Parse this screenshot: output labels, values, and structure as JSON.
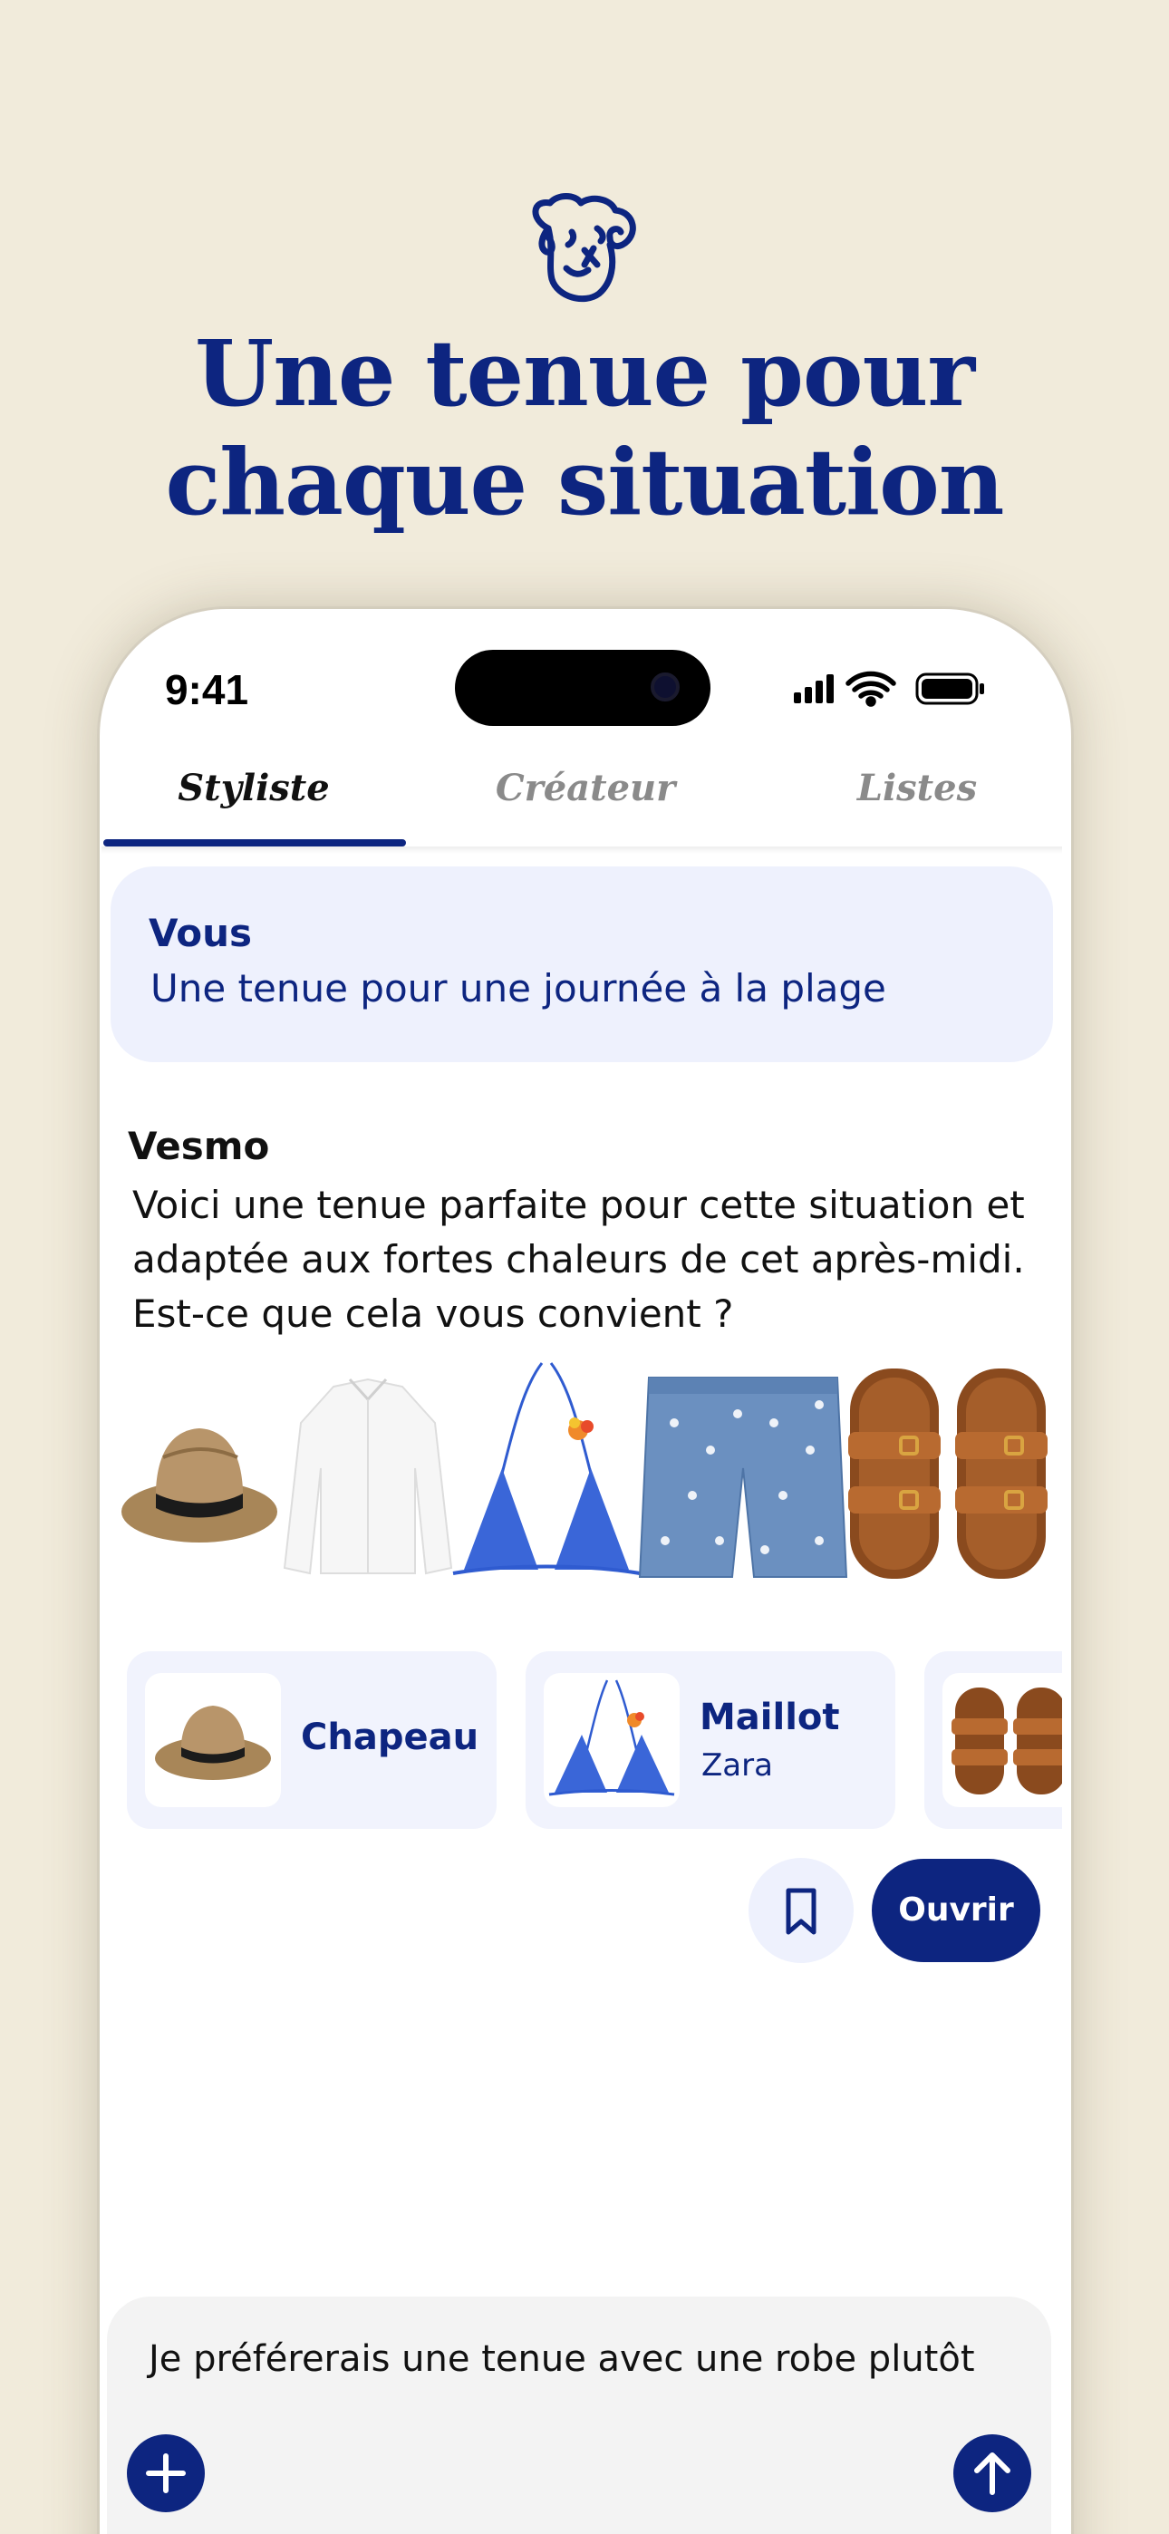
{
  "headline": {
    "line1": "Une tenue pour",
    "line2": "chaque situation"
  },
  "status_bar": {
    "time": "9:41",
    "icons": [
      "signal-icon",
      "wifi-icon",
      "battery-icon"
    ]
  },
  "tabs": [
    {
      "label": "Styliste",
      "active": true
    },
    {
      "label": "Créateur",
      "active": false
    },
    {
      "label": "Listes",
      "active": false
    }
  ],
  "chat": {
    "user": {
      "name": "Vous",
      "message": "Une tenue pour une journée à la plage"
    },
    "bot": {
      "name": "Vesmo",
      "message": "Voici une tenue parfaite pour cette situation et adaptée aux fortes chaleurs de cet après-midi. Est-ce que cela vous convient ?"
    }
  },
  "outfit_items": [
    "hat",
    "white-shirt",
    "bikini",
    "denim-shorts",
    "sandals"
  ],
  "product_cards": [
    {
      "title": "Chapeau",
      "subtitle": ""
    },
    {
      "title": "Maillot",
      "subtitle": "Zara"
    },
    {
      "title": "",
      "subtitle": ""
    }
  ],
  "actions": {
    "open_label": "Ouvrir"
  },
  "composer": {
    "text": "Je préférerais une tenue avec une robe plutôt"
  },
  "colors": {
    "background": "#f1ebdb",
    "brand_navy": "#0d2580",
    "bubble": "#eef1fd"
  }
}
